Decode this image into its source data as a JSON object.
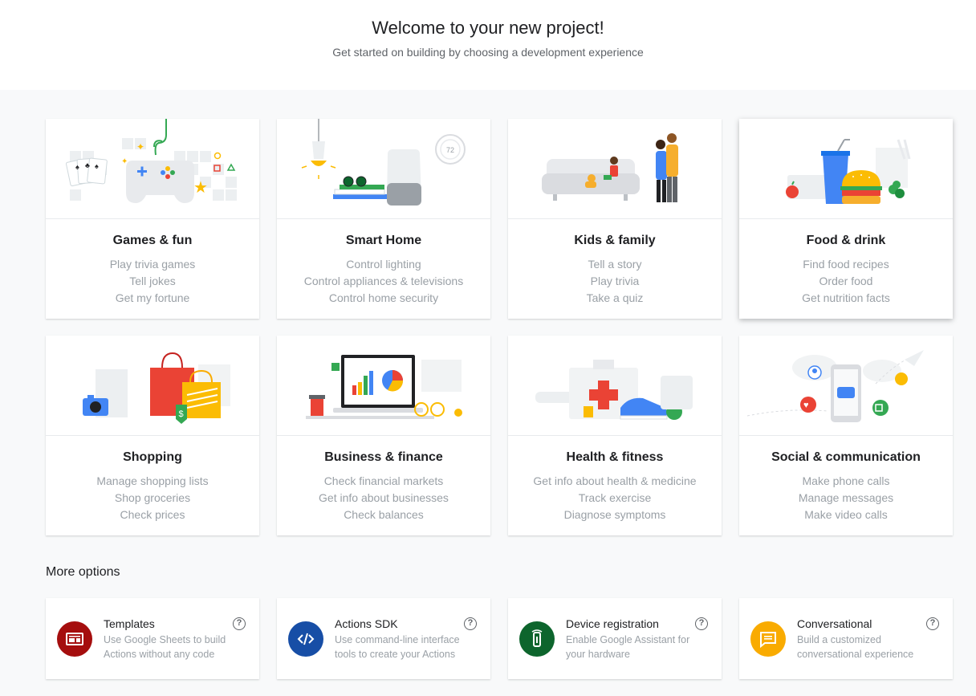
{
  "header": {
    "title": "Welcome to your new project!",
    "subtitle": "Get started on building by choosing a development experience"
  },
  "categories": [
    {
      "title": "Games & fun",
      "lines": [
        "Play trivia games",
        "Tell jokes",
        "Get my fortune"
      ]
    },
    {
      "title": "Smart Home",
      "lines": [
        "Control lighting",
        "Control appliances & televisions",
        "Control home security"
      ]
    },
    {
      "title": "Kids & family",
      "lines": [
        "Tell a story",
        "Play trivia",
        "Take a quiz"
      ]
    },
    {
      "title": "Food & drink",
      "lines": [
        "Find food recipes",
        "Order food",
        "Get nutrition facts"
      ]
    },
    {
      "title": "Shopping",
      "lines": [
        "Manage shopping lists",
        "Shop groceries",
        "Check prices"
      ]
    },
    {
      "title": "Business & finance",
      "lines": [
        "Check financial markets",
        "Get info about businesses",
        "Check balances"
      ]
    },
    {
      "title": "Health & fitness",
      "lines": [
        "Get info about health & medicine",
        "Track exercise",
        "Diagnose symptoms"
      ]
    },
    {
      "title": "Social & communication",
      "lines": [
        "Make phone calls",
        "Manage messages",
        "Make video calls"
      ]
    }
  ],
  "more_options": {
    "title": "More options",
    "items": [
      {
        "title": "Templates",
        "desc": "Use Google Sheets to build Actions without any code",
        "icon": "sheet-template-icon",
        "color": "#a50e0e",
        "help": "?"
      },
      {
        "title": "Actions SDK",
        "desc": "Use command-line interface tools to create your Actions",
        "icon": "code-icon",
        "color": "#174ea6",
        "help": "?"
      },
      {
        "title": "Device registration",
        "desc": "Enable Google Assistant for your hardware",
        "icon": "device-icon",
        "color": "#0d652d",
        "help": "?"
      },
      {
        "title": "Conversational",
        "desc": "Build a customized conversational experience",
        "icon": "chat-icon",
        "color": "#f9ab00",
        "help": "?"
      }
    ]
  },
  "illustration_labels": {
    "thermostat": "72"
  }
}
